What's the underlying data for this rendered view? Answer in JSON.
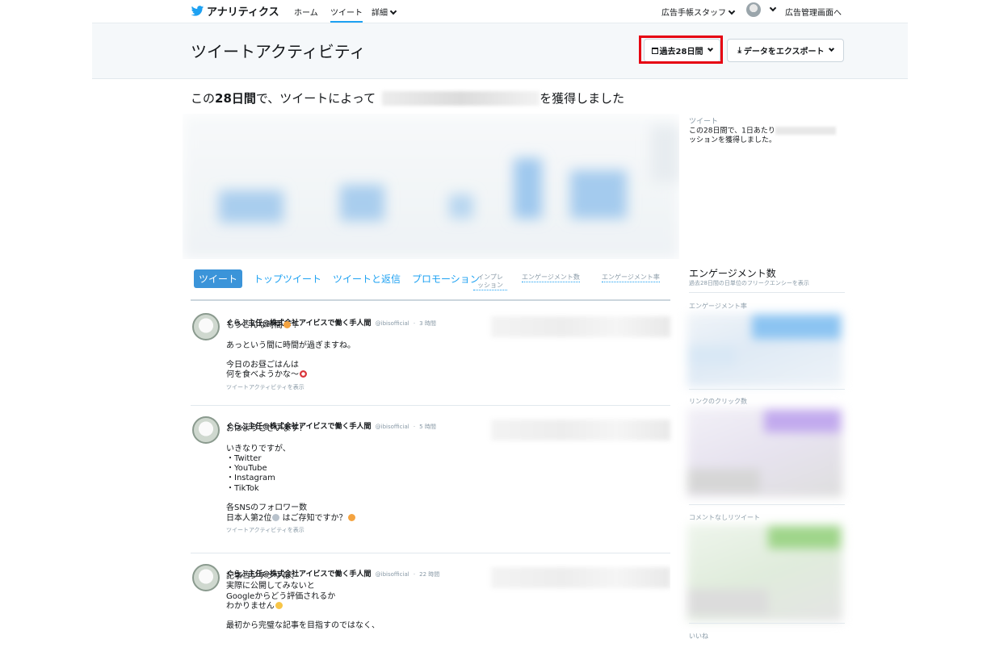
{
  "nav": {
    "brand": "アナリティクス",
    "links": [
      "ホーム",
      "ツイート",
      "詳細"
    ],
    "account": "広告手帳スタッフ",
    "ads_link": "広告管理画面へ"
  },
  "header": {
    "title": "ツイートアクティビティ",
    "range_button": "過去28日間",
    "export_button": "データをエクスポート"
  },
  "summary": {
    "prefix": "この",
    "period": "28日間",
    "middle": "で、ツイートによって",
    "suffix": "を獲得しました"
  },
  "side_note": {
    "label": "ツイート",
    "line1": "この28日間で、1日あたり",
    "line2": "ッションを獲得しました。"
  },
  "tabs": [
    "ツイート",
    "トップツイート",
    "ツイートと返信",
    "プロモーション"
  ],
  "columns": [
    "インプレ\nッション",
    "エンゲージメント数",
    "エンゲージメント率"
  ],
  "tweets": [
    {
      "name": "ぐらぶ主任@株式会社アイビスで働く手人間",
      "handle": "@ibisofficial",
      "time": "3 時間",
      "lines": [
        "もうこんな時間",
        "",
        "あっという間に時間が過ぎますね。",
        "",
        "今日のお昼ごはんは",
        "何を食べようかな〜"
      ],
      "activity": "ツイートアクティビティを表示"
    },
    {
      "name": "ぐらぶ主任@株式会社アイビスで働く手人間",
      "handle": "@ibisofficial",
      "time": "5 時間",
      "lines": [
        "おはようございます！",
        "",
        "いきなりですが、",
        "・Twitter",
        "・YouTube",
        "・Instagram",
        "・TikTok",
        "",
        "各SNSのフォロワー数",
        "日本人第2位",
        "はご存知ですか？"
      ],
      "activity": "ツイートアクティビティを表示"
    },
    {
      "name": "ぐらぶ主任@株式会社アイビスで働く手人間",
      "handle": "@ibisofficial",
      "time": "22 時間",
      "lines": [
        "記事コンテンツは、",
        "実際に公開してみないと",
        "Googleからどう評価されるか",
        "わかりません",
        "",
        "最初から完璧な記事を目指すのではなく、"
      ],
      "activity": ""
    }
  ],
  "right_panel": {
    "title": "エンゲージメント数",
    "subtitle": "過去28日間の日単位のフリークエンシーを表示",
    "sections": [
      "エンゲージメント率",
      "リンクのクリック数",
      "コメントなしリツイート",
      "いいね"
    ]
  },
  "colors": {
    "accent": "#1da1f2",
    "highlight": "#e60012",
    "engagement_rate": "#7fbff0",
    "link_clicks": "#b79ee6",
    "retweets": "#8ed07a"
  }
}
